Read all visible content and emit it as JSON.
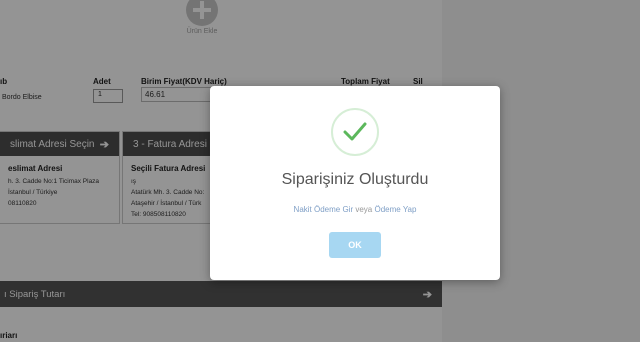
{
  "add_product": {
    "label": "Ürün Ekle",
    "icon": "plus-icon"
  },
  "product_table": {
    "headers": {
      "product": "ıb",
      "quantity": "Adet",
      "unit_price": "Birim Fiyat(KDV Hariç)",
      "total_price": "Toplam Fiyat",
      "delete": "Sil"
    },
    "row": {
      "product_name": "Bordo Elbise",
      "quantity": "1",
      "unit_price": "46.61"
    }
  },
  "shipping_panel": {
    "header": "slimat Adresi Seçin",
    "title": "eslimat Adresi",
    "lines": [
      "h. 3. Cadde No:1 Ticimax Plaza",
      "İstanbul / Türkiye",
      "08110820"
    ]
  },
  "billing_panel": {
    "header": "3 - Fatura Adresi S",
    "title": "Seçili Fatura Adresi",
    "lines": [
      "ış",
      "Atatürk Mh. 3. Cadde No:",
      "Ataşehir / İstanbul / Türk",
      "Tel: 908508110820"
    ]
  },
  "order_total_bar": {
    "label": "ı Sipariş Tutarı"
  },
  "bottom_label": "ıriarı",
  "modal": {
    "title": "Siparişiniz Oluşturdu",
    "link_cash": "Nakit Ödeme Gir",
    "link_separator": "veya",
    "link_pay": "Ödeme Yap",
    "ok_label": "OK",
    "icon": "checkmark-icon",
    "accent_color": "#5cb85c",
    "button_color": "#a7d7f2"
  }
}
